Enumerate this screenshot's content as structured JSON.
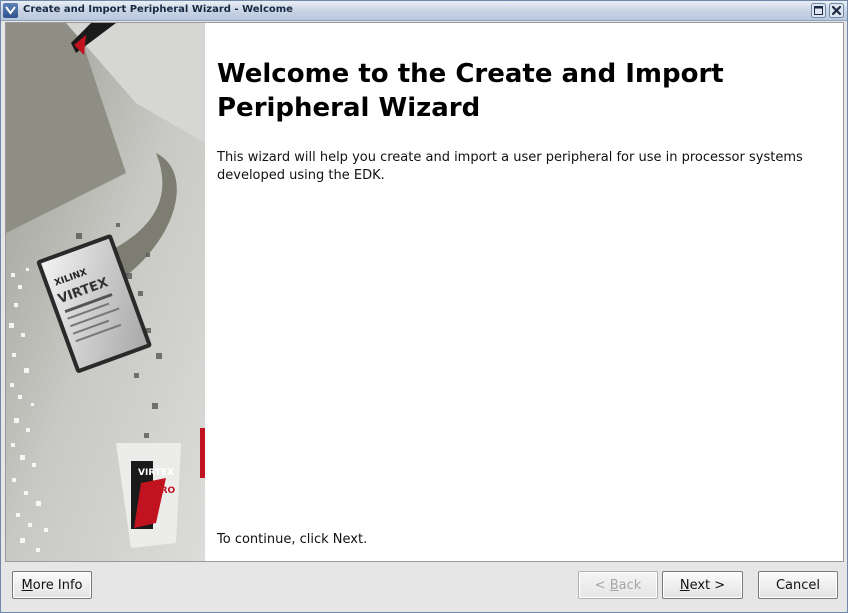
{
  "window": {
    "title": "Create and Import Peripheral Wizard - Welcome"
  },
  "side_image": {
    "chip_brand_line1": "XILINX",
    "chip_brand_line2": "VIRTEX",
    "logo_text_line1": "VIRTEX",
    "logo_text_line2": "PRO"
  },
  "content": {
    "heading": "Welcome to the Create and Import Peripheral Wizard",
    "description": "This wizard will help you create and import a user peripheral for use in processor systems developed using the EDK.",
    "continue_text": "To continue, click Next."
  },
  "buttons": {
    "more_info": {
      "mnemonic": "M",
      "rest": "ore Info"
    },
    "back": {
      "prefix": "< ",
      "mnemonic": "B",
      "rest": "ack",
      "enabled": false
    },
    "next": {
      "mnemonic": "N",
      "rest": "ext >"
    },
    "cancel": {
      "label": "Cancel"
    }
  },
  "colors": {
    "title_gradient_top": "#e9eef5",
    "title_gradient_bottom": "#b9c8dc",
    "logo_red": "#c1121f",
    "panel_bg": "#e6e6e6"
  }
}
